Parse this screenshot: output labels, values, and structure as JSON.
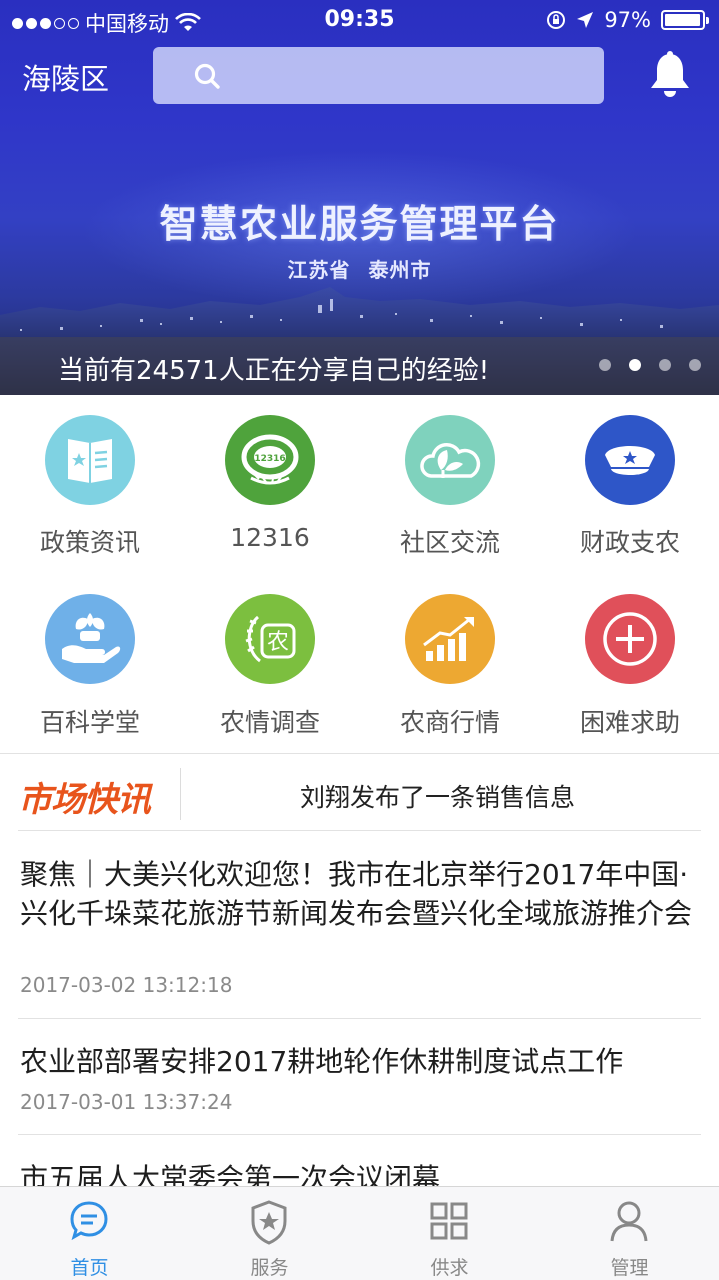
{
  "status_bar": {
    "carrier": "中国移动",
    "time": "09:35",
    "battery": "97%",
    "battery_level": 0.97
  },
  "header": {
    "region": "海陵区",
    "search_placeholder": "",
    "icons": [
      "search-icon",
      "bell-icon"
    ]
  },
  "banner": {
    "title": "智慧农业服务管理平台",
    "subtitle": "江苏省 泰州市",
    "ticker": "当前有24571人正在分享自己的经验!",
    "page_count": 4,
    "active_page": 2
  },
  "services": [
    {
      "label": "政策资讯",
      "icon": "newspaper-icon",
      "color": "#7fd2e2"
    },
    {
      "label": "12316",
      "icon": "hotline-12316-icon",
      "color": "#4fa33c"
    },
    {
      "label": "社区交流",
      "icon": "leaf-cloud-icon",
      "color": "#7fd2bd"
    },
    {
      "label": "财政支农",
      "icon": "officer-cap-icon",
      "color": "#2e56c8"
    },
    {
      "label": "百科学堂",
      "icon": "hand-sprout-icon",
      "color": "#6fb0e8"
    },
    {
      "label": "农情调查",
      "icon": "farm-survey-icon",
      "color": "#7cbf3f"
    },
    {
      "label": "农商行情",
      "icon": "rising-chart-icon",
      "color": "#eda832"
    },
    {
      "label": "困难求助",
      "icon": "plus-help-icon",
      "color": "#e0505a"
    }
  ],
  "market": {
    "logo": "市场快讯",
    "latest": "刘翔发布了一条销售信息"
  },
  "news": [
    {
      "title": "聚焦｜大美兴化欢迎您！我市在北京举行2017年中国·兴化千垛菜花旅游节新闻发布会暨兴化全域旅游推介会",
      "time": "2017-03-02 13:12:18"
    },
    {
      "title": "农业部部署安排2017耕地轮作休耕制度试点工作",
      "time": "2017-03-01 13:37:24"
    },
    {
      "title": "市五届人大常委会第一次会议闭幕",
      "time": ""
    }
  ],
  "tabs": [
    {
      "label": "首页",
      "icon": "chat-bubble-icon",
      "active": true
    },
    {
      "label": "服务",
      "icon": "shield-star-icon",
      "active": false
    },
    {
      "label": "供求",
      "icon": "grid-icon",
      "active": false
    },
    {
      "label": "管理",
      "icon": "user-icon",
      "active": false
    }
  ],
  "colors": {
    "accent": "#2f8fe4",
    "market_logo": "#e8541c",
    "banner": "#2f36c9"
  }
}
